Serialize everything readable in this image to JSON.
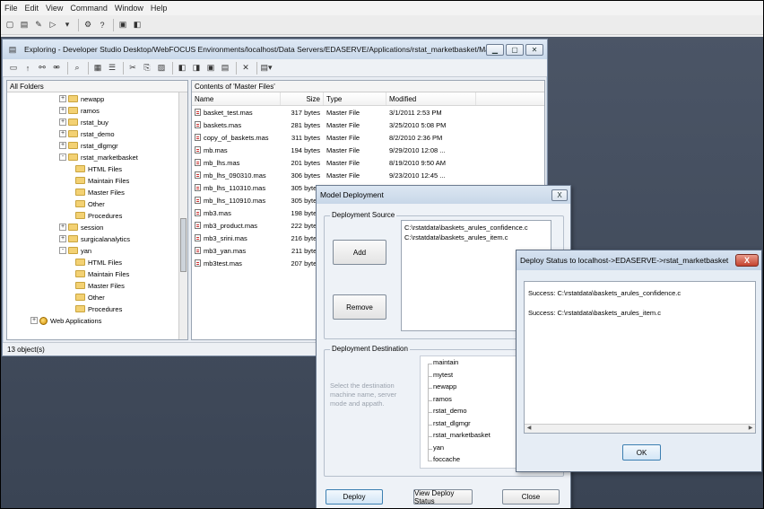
{
  "menubar": [
    "File",
    "Edit",
    "View",
    "Command",
    "Window",
    "Help"
  ],
  "explorer": {
    "title": "Exploring - Developer Studio Desktop/WebFOCUS Environments/localhost/Data Servers/EDASERVE/Applications/rstat_marketbasket/Master Files",
    "tree_header": "All Folders",
    "list_caption": "Contents of 'Master Files'",
    "status": "13 object(s)",
    "tree": [
      {
        "label": "newapp",
        "level": 1,
        "expander": "+"
      },
      {
        "label": "ramos",
        "level": 1,
        "expander": "+"
      },
      {
        "label": "rstat_buy",
        "level": 1,
        "expander": "+"
      },
      {
        "label": "rstat_demo",
        "level": 1,
        "expander": "+"
      },
      {
        "label": "rstat_dlgmgr",
        "level": 1,
        "expander": "+"
      },
      {
        "label": "rstat_marketbasket",
        "level": 1,
        "expander": "-"
      },
      {
        "label": "HTML Files",
        "level": 2,
        "expander": ""
      },
      {
        "label": "Maintain Files",
        "level": 2,
        "expander": ""
      },
      {
        "label": "Master Files",
        "level": 2,
        "expander": ""
      },
      {
        "label": "Other",
        "level": 2,
        "expander": ""
      },
      {
        "label": "Procedures",
        "level": 2,
        "expander": ""
      },
      {
        "label": "session",
        "level": 1,
        "expander": "+"
      },
      {
        "label": "surgicalanalytics",
        "level": 1,
        "expander": "+"
      },
      {
        "label": "yan",
        "level": 1,
        "expander": "-"
      },
      {
        "label": "HTML Files",
        "level": 2,
        "expander": ""
      },
      {
        "label": "Maintain Files",
        "level": 2,
        "expander": ""
      },
      {
        "label": "Master Files",
        "level": 2,
        "expander": ""
      },
      {
        "label": "Other",
        "level": 2,
        "expander": ""
      },
      {
        "label": "Procedures",
        "level": 2,
        "expander": ""
      },
      {
        "label": "Web Applications",
        "level": 0,
        "expander": "+",
        "icon": "globe"
      }
    ],
    "columns": [
      "Name",
      "Size",
      "Type",
      "Modified"
    ],
    "files": [
      {
        "name": "basket_test.mas",
        "size": "317 bytes",
        "type": "Master File",
        "modified": "3/1/2011 2:53 PM"
      },
      {
        "name": "baskets.mas",
        "size": "281 bytes",
        "type": "Master File",
        "modified": "3/25/2010 5:08 PM"
      },
      {
        "name": "copy_of_baskets.mas",
        "size": "311 bytes",
        "type": "Master File",
        "modified": "8/2/2010 2:36 PM"
      },
      {
        "name": "mb.mas",
        "size": "194 bytes",
        "type": "Master File",
        "modified": "9/29/2010 12:08 ..."
      },
      {
        "name": "mb_lhs.mas",
        "size": "201 bytes",
        "type": "Master File",
        "modified": "8/19/2010 9:50 AM"
      },
      {
        "name": "mb_lhs_090310.mas",
        "size": "306 bytes",
        "type": "Master File",
        "modified": "9/23/2010 12:45 ..."
      },
      {
        "name": "mb_lhs_110310.mas",
        "size": "305 bytes",
        "type": "",
        "modified": ""
      },
      {
        "name": "mb_lhs_110910.mas",
        "size": "305 bytes",
        "type": "",
        "modified": ""
      },
      {
        "name": "mb3.mas",
        "size": "198 bytes",
        "type": "",
        "modified": ""
      },
      {
        "name": "mb3_product.mas",
        "size": "222 bytes",
        "type": "",
        "modified": ""
      },
      {
        "name": "mb3_srini.mas",
        "size": "216 bytes",
        "type": "",
        "modified": ""
      },
      {
        "name": "mb3_yan.mas",
        "size": "211 bytes",
        "type": "",
        "modified": ""
      },
      {
        "name": "mb3test.mas",
        "size": "207 bytes",
        "type": "",
        "modified": ""
      }
    ]
  },
  "deploy": {
    "title": "Model Deployment",
    "close_glyph": "X",
    "source_label": "Deployment Source",
    "add_label": "Add",
    "remove_label": "Remove",
    "sources": [
      "C:\\rstatdata\\baskets_arules_confidence.c",
      "C:\\rstatdata\\baskets_arules_item.c"
    ],
    "destination_label": "Deployment Destination",
    "destination_hint": "Select the destination machine name, server mode and appath.",
    "destinations": [
      "maintain",
      "mytest",
      "newapp",
      "ramos",
      "rstat_demo",
      "rstat_dlgmgr",
      "rstat_marketbasket",
      "yan",
      "foccache"
    ],
    "deploy_label": "Deploy",
    "view_status_label": "View Deploy Status",
    "close_label": "Close"
  },
  "status": {
    "title": "Deploy Status to localhost->EDASERVE->rstat_marketbasket",
    "close_glyph": "X",
    "messages": [
      "Success: C:\\rstatdata\\baskets_arules_confidence.c",
      "Success: C:\\rstatdata\\baskets_arules_item.c"
    ],
    "ok_label": "OK"
  }
}
